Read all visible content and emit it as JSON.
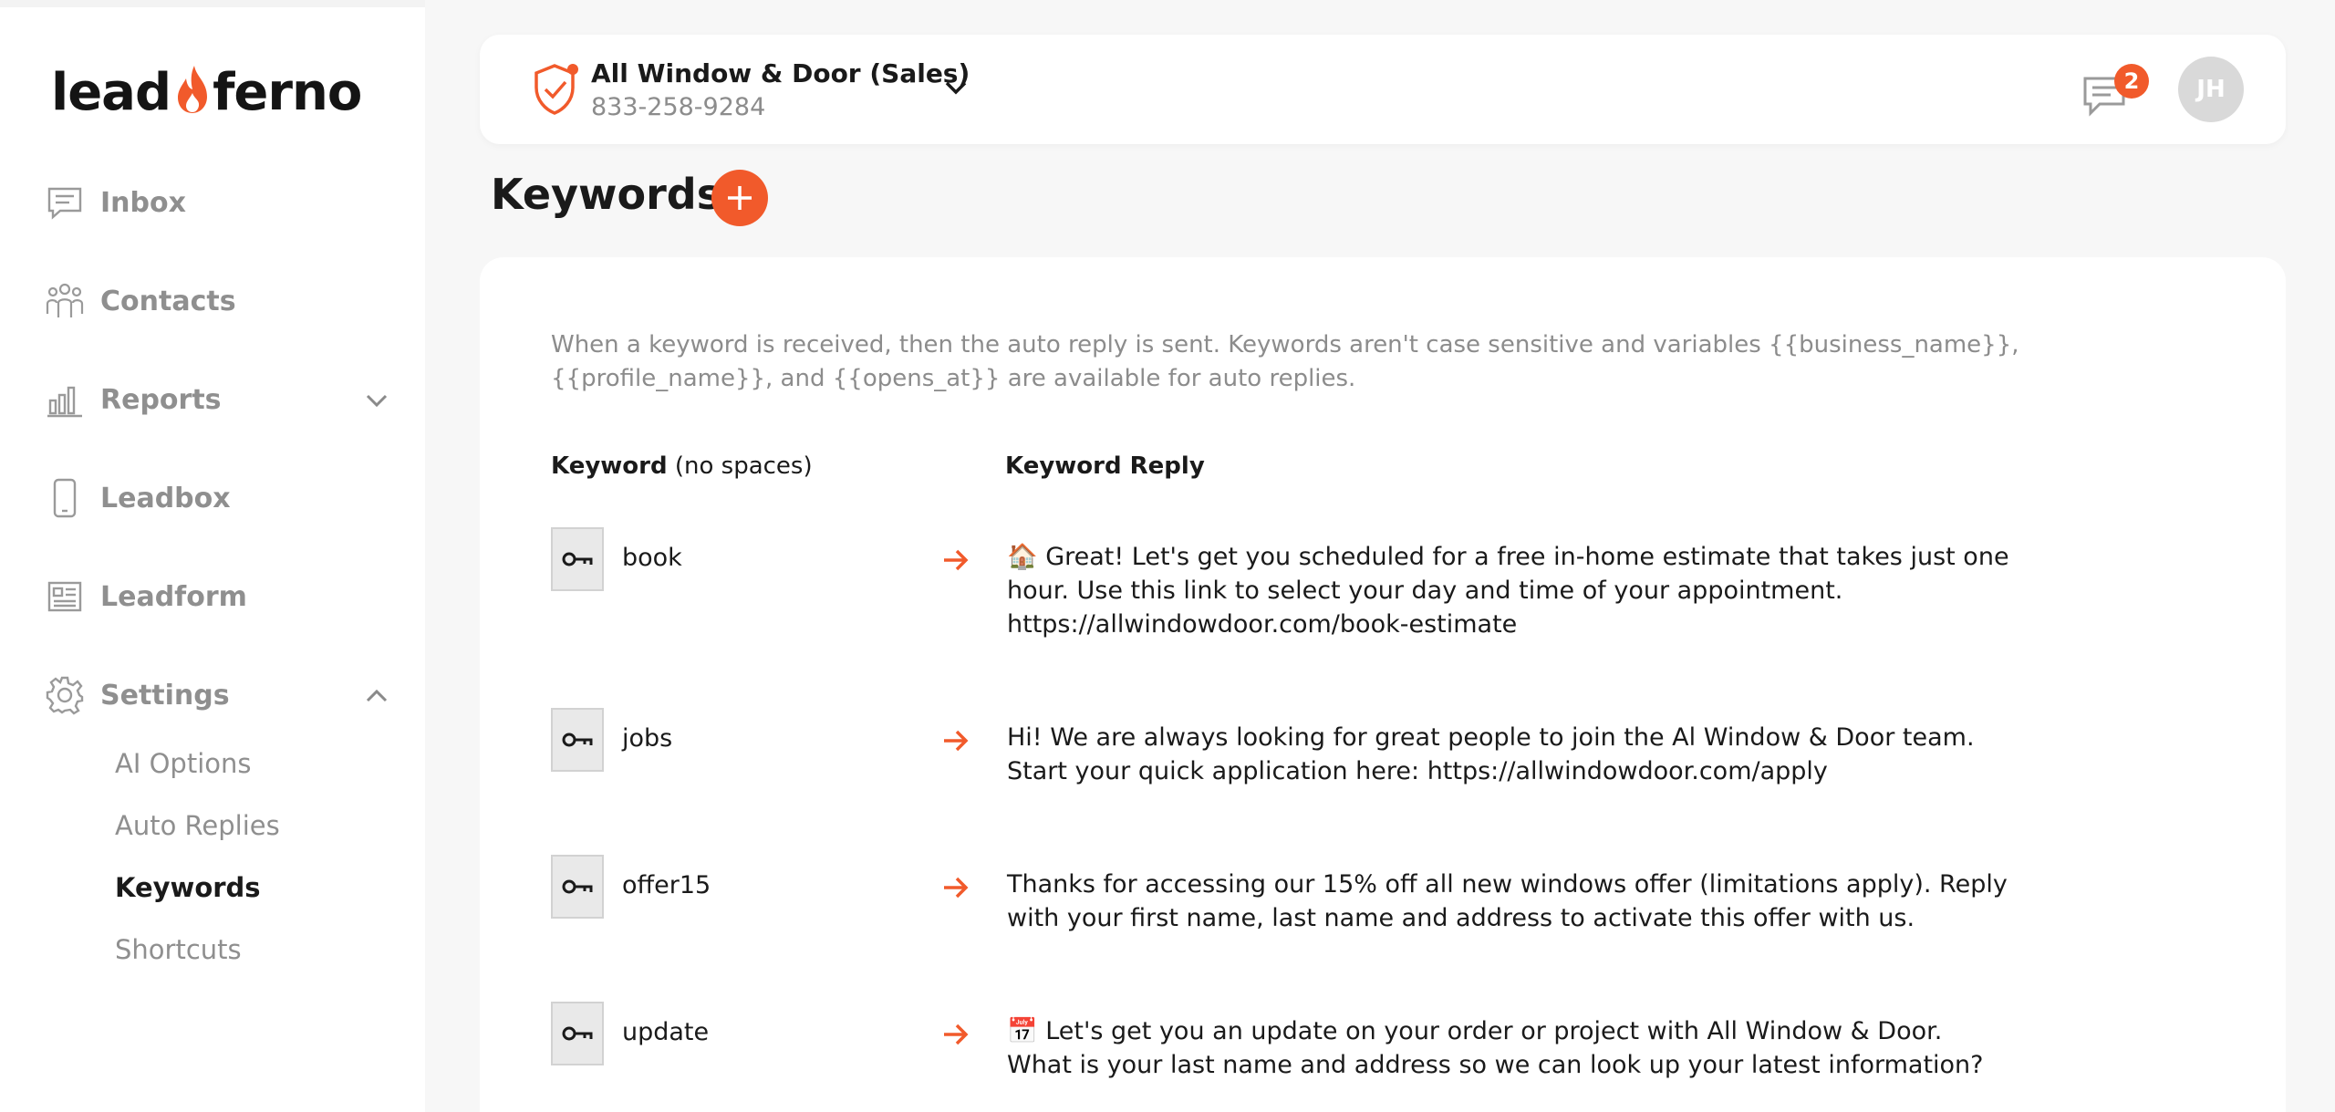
{
  "brand": {
    "logo_left": "lead",
    "logo_right": "ferno",
    "accent": "#f15a2b"
  },
  "sidebar": {
    "items": [
      {
        "label": "Inbox",
        "icon": "inbox-icon"
      },
      {
        "label": "Contacts",
        "icon": "contacts-icon"
      },
      {
        "label": "Reports",
        "icon": "reports-icon"
      },
      {
        "label": "Leadbox",
        "icon": "leadbox-icon"
      },
      {
        "label": "Leadform",
        "icon": "leadform-icon"
      },
      {
        "label": "Settings",
        "icon": "gear-icon"
      }
    ],
    "settings_subitems": [
      {
        "label": "AI Options"
      },
      {
        "label": "Auto Replies"
      },
      {
        "label": "Keywords"
      },
      {
        "label": "Shortcuts"
      }
    ]
  },
  "header": {
    "account_name": "All Window & Door (Sales)",
    "account_phone": "833-258-9284",
    "message_count": "2",
    "avatar_initials": "JH"
  },
  "page": {
    "title": "Keywords",
    "description": "When a keyword is received, then the auto reply is sent. Keywords aren't case sensitive and variables {{business_name}}, {{profile_name}}, and {{opens_at}} are available for auto replies.",
    "col_keyword_bold": "Keyword",
    "col_keyword_note": " (no spaces)",
    "col_reply": "Keyword Reply"
  },
  "keywords": [
    {
      "keyword": "book",
      "reply": "🏠 Great! Let's get you scheduled for a free in-home estimate that takes just one hour. Use this link to select your day and time of your appointment. https://allwindowdoor.com/book-estimate"
    },
    {
      "keyword": "jobs",
      "reply": "Hi! We are always looking for great people to join the Al Window & Door team. Start your quick application here: https://allwindowdoor.com/apply"
    },
    {
      "keyword": "offer15",
      "reply": "Thanks for accessing our 15% off all new windows offer (limitations apply). Reply with your first name, last name and address to activate this offer with us."
    },
    {
      "keyword": "update",
      "reply": "📅 Let's get you an update on your order or project with All Window & Door. What is your last name and address so we can look up your latest information?"
    }
  ]
}
